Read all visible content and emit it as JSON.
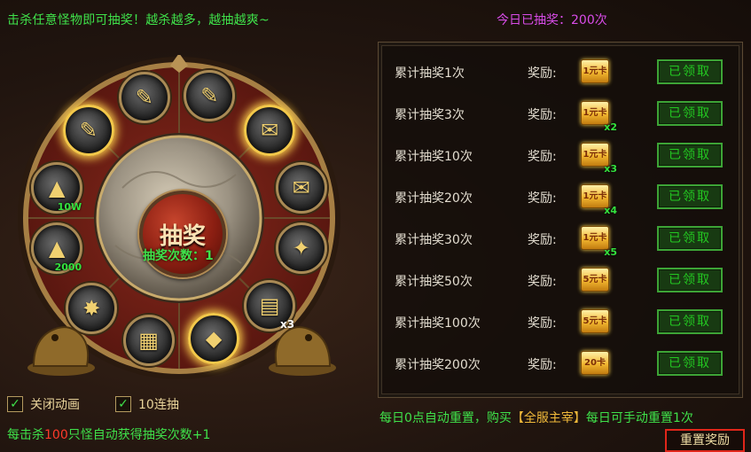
{
  "header": {
    "tip": "击杀任意怪物即可抽奖！越杀越多，越抽越爽~",
    "today_draws": "今日已抽奖：200次"
  },
  "wheel": {
    "center_label": "抽奖",
    "draw_count": "抽奖次数：1",
    "slots": [
      {
        "icon": "gold-ingot-icon",
        "glyph": "▲",
        "qty": "2000",
        "highlight": false
      },
      {
        "icon": "gold-ingot-icon",
        "glyph": "▲",
        "qty": "10W",
        "highlight": false
      },
      {
        "icon": "scroll-icon",
        "glyph": "✎",
        "qty": "",
        "highlight": true
      },
      {
        "icon": "scroll-icon",
        "glyph": "✎",
        "qty": "",
        "highlight": false
      },
      {
        "icon": "purple-scroll-icon",
        "glyph": "✎",
        "qty": "",
        "highlight": false
      },
      {
        "icon": "red-envelope-icon",
        "glyph": "✉",
        "qty": "",
        "highlight": true
      },
      {
        "icon": "red-envelope-icon",
        "glyph": "✉",
        "qty": "",
        "highlight": false
      },
      {
        "icon": "crystal-icon",
        "glyph": "✦",
        "qty": "",
        "highlight": false
      },
      {
        "icon": "book-icon",
        "glyph": "▤",
        "qty": "x3",
        "highlight": false
      },
      {
        "icon": "gold-cube-icon",
        "glyph": "◆",
        "qty": "",
        "highlight": true
      },
      {
        "icon": "scroll-box-icon",
        "glyph": "▦",
        "qty": "",
        "highlight": false
      },
      {
        "icon": "treasure-pile-icon",
        "glyph": "✸",
        "qty": "",
        "highlight": false
      }
    ]
  },
  "options": {
    "close_animation": "关闭动画",
    "ten_draw": "10连抽"
  },
  "bottom_tip": {
    "part1": "每击杀",
    "num": "100",
    "part2": "只怪自动获得",
    "part3": "抽奖次数",
    "part4": "+1"
  },
  "rewards": {
    "reward_label": "奖励:",
    "claimed_label": "已领取",
    "rows": [
      {
        "label": "累计抽奖1次",
        "card": "1元卡",
        "mult": ""
      },
      {
        "label": "累计抽奖3次",
        "card": "1元卡",
        "mult": "x2"
      },
      {
        "label": "累计抽奖10次",
        "card": "1元卡",
        "mult": "x3"
      },
      {
        "label": "累计抽奖20次",
        "card": "1元卡",
        "mult": "x4"
      },
      {
        "label": "累计抽奖30次",
        "card": "1元卡",
        "mult": "x5"
      },
      {
        "label": "累计抽奖50次",
        "card": "5元卡",
        "mult": ""
      },
      {
        "label": "累计抽奖100次",
        "card": "5元卡",
        "mult": ""
      },
      {
        "label": "累计抽奖200次",
        "card": "20卡",
        "mult": ""
      }
    ]
  },
  "footer": {
    "reset_tip_1": "每日0点自动重置，购买",
    "reset_tip_vip": "【全服主宰】",
    "reset_tip_2": "每日可手动重置1次",
    "reset_button": "重置奖励"
  },
  "colors": {
    "accent_green": "#3fe14a",
    "accent_magenta": "#d94ce8",
    "gold": "#f0b93a",
    "reset_border": "#e0261a"
  }
}
